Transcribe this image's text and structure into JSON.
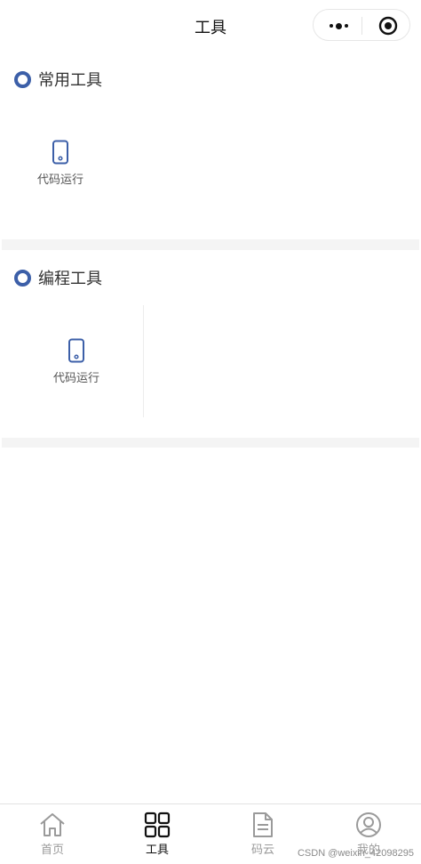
{
  "header": {
    "title": "工具",
    "more_icon": "more-dots-icon",
    "close_icon": "target-circle-icon"
  },
  "sections": [
    {
      "title": "常用工具",
      "tools": [
        {
          "label": "代码运行",
          "icon": "phone-icon"
        }
      ]
    },
    {
      "title": "编程工具",
      "tools": [
        {
          "label": "代码运行",
          "icon": "phone-icon"
        }
      ]
    }
  ],
  "tabbar": {
    "items": [
      {
        "label": "首页",
        "icon": "home-icon",
        "active": false
      },
      {
        "label": "工具",
        "icon": "grid-icon",
        "active": true
      },
      {
        "label": "码云",
        "icon": "document-icon",
        "active": false
      },
      {
        "label": "我的",
        "icon": "user-circle-icon",
        "active": false
      }
    ]
  },
  "watermark": "CSDN @weixin_42098295",
  "colors": {
    "accent": "#3c5fa8",
    "tab_active": "#111111",
    "tab_inactive": "#9a9a9a",
    "divider_bar": "#f4f4f4"
  }
}
